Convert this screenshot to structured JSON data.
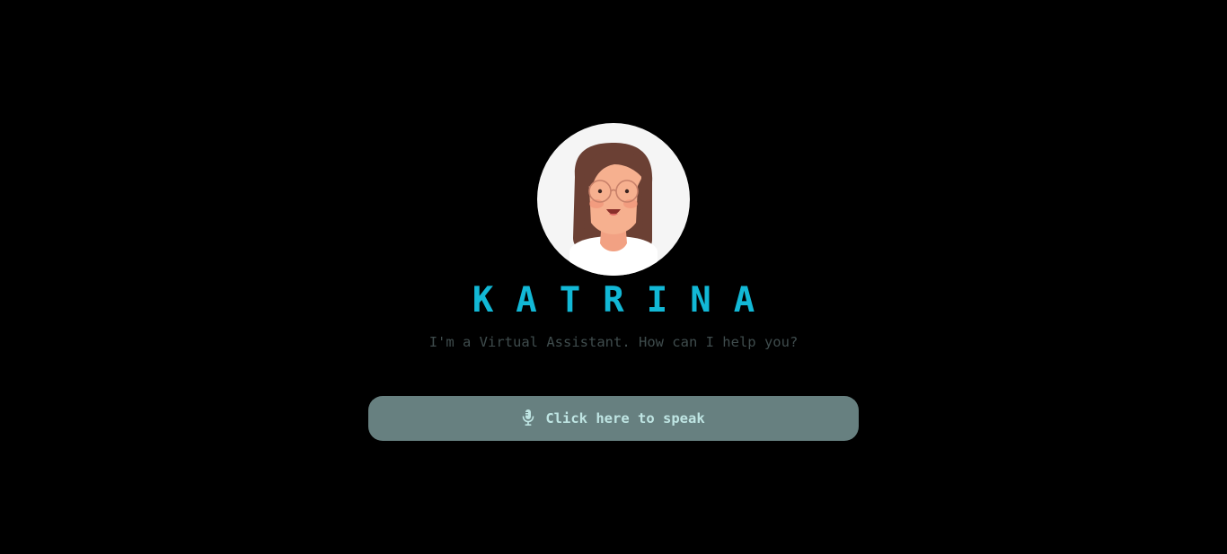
{
  "assistant": {
    "name": "KATRINA",
    "tagline": "I'm a Virtual Assistant. How can I help you?"
  },
  "speak_button": {
    "label": "Click here to speak",
    "icon": "microphone-icon"
  },
  "avatar": {
    "icon": "woman-with-glasses-avatar"
  },
  "colors": {
    "background": "#000000",
    "name": "#12b8d6",
    "tagline": "#3f4c4d",
    "button_bg": "#678080",
    "button_text": "#bfe5e3",
    "avatar_bg": "#f5f5f5"
  }
}
